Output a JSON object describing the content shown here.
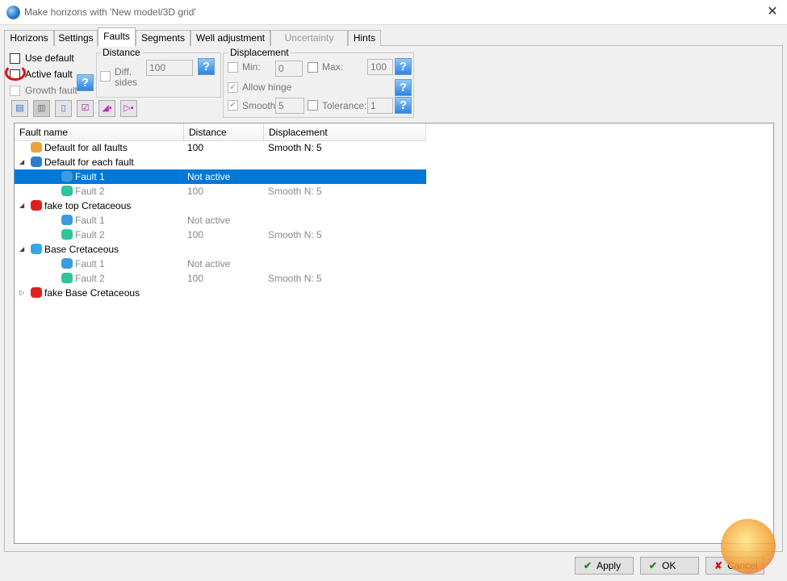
{
  "window": {
    "title": "Make horizons with 'New model/3D grid'",
    "close": "✕"
  },
  "tabs": [
    {
      "label": "Horizons"
    },
    {
      "label": "Settings"
    },
    {
      "label": "Faults",
      "selected": true
    },
    {
      "label": "Segments"
    },
    {
      "label": "Well adjustment"
    },
    {
      "label": "Uncertainty",
      "disabled": true
    },
    {
      "label": "Hints"
    }
  ],
  "options": {
    "use_default": "Use default",
    "active_fault": "Active fault",
    "growth_fault": "Growth fault",
    "help": "?"
  },
  "distance": {
    "title": "Distance",
    "diff_sides": "Diff.",
    "diff_sides2": "sides",
    "value": "100"
  },
  "displacement": {
    "title": "Displacement",
    "min_label": "Min:",
    "min_value": "0",
    "max_label": "Max:",
    "max_value": "100",
    "allow_hinge": "Allow hinge",
    "smooth_label": "Smooth:",
    "smooth_value": "5",
    "tolerance_label": "Tolerance:",
    "tolerance_value": "1"
  },
  "tree": {
    "columns": [
      "Fault name",
      "Distance",
      "Displacement"
    ],
    "rows": [
      {
        "name": "Default for all faults",
        "distance": "100",
        "displacement": "Smooth N: 5",
        "level": 0,
        "icon": "folder-fault-icon",
        "color": "#e8a33a"
      },
      {
        "name": "Default for each fault",
        "distance": "",
        "displacement": "",
        "level": 0,
        "expander": "◢",
        "icon": "horizon-icon",
        "color": "#2a7fd0"
      },
      {
        "name": "Fault 1",
        "distance": "Not active",
        "displacement": "",
        "level": 1,
        "selected": true,
        "icon": "fault-icon",
        "color": "#3c9be0"
      },
      {
        "name": "Fault 2",
        "distance": "100",
        "displacement": "Smooth N: 5",
        "level": 1,
        "grey": true,
        "icon": "fault-icon",
        "color": "#2fc49a"
      },
      {
        "name": "fake top Cretaceous",
        "distance": "",
        "displacement": "",
        "level": 0,
        "expander": "◢",
        "icon": "horizon-icon",
        "color": "#e02020"
      },
      {
        "name": "Fault 1",
        "distance": "Not active",
        "displacement": "",
        "level": 1,
        "grey": true,
        "icon": "fault-icon",
        "color": "#3c9be0"
      },
      {
        "name": "Fault 2",
        "distance": "100",
        "displacement": "Smooth N: 5",
        "level": 1,
        "grey": true,
        "icon": "fault-icon",
        "color": "#2fc49a"
      },
      {
        "name": "Base Cretaceous",
        "distance": "",
        "displacement": "",
        "level": 0,
        "expander": "◢",
        "icon": "horizon-icon",
        "color": "#3aa5e8"
      },
      {
        "name": "Fault 1",
        "distance": "Not active",
        "displacement": "",
        "level": 1,
        "grey": true,
        "icon": "fault-icon",
        "color": "#3c9be0"
      },
      {
        "name": "Fault 2",
        "distance": "100",
        "displacement": "Smooth N: 5",
        "level": 1,
        "grey": true,
        "icon": "fault-icon",
        "color": "#2fc49a"
      },
      {
        "name": "fake Base Cretaceous",
        "distance": "",
        "displacement": "",
        "level": 0,
        "expander": "▷",
        "icon": "horizon-icon",
        "color": "#e02020"
      }
    ]
  },
  "buttons": {
    "apply": "Apply",
    "ok": "OK",
    "cancel": "Cancel",
    "check": "✔",
    "cross": "✘"
  },
  "colors": {
    "selection": "#0078d7",
    "annotation": "#e01010"
  }
}
